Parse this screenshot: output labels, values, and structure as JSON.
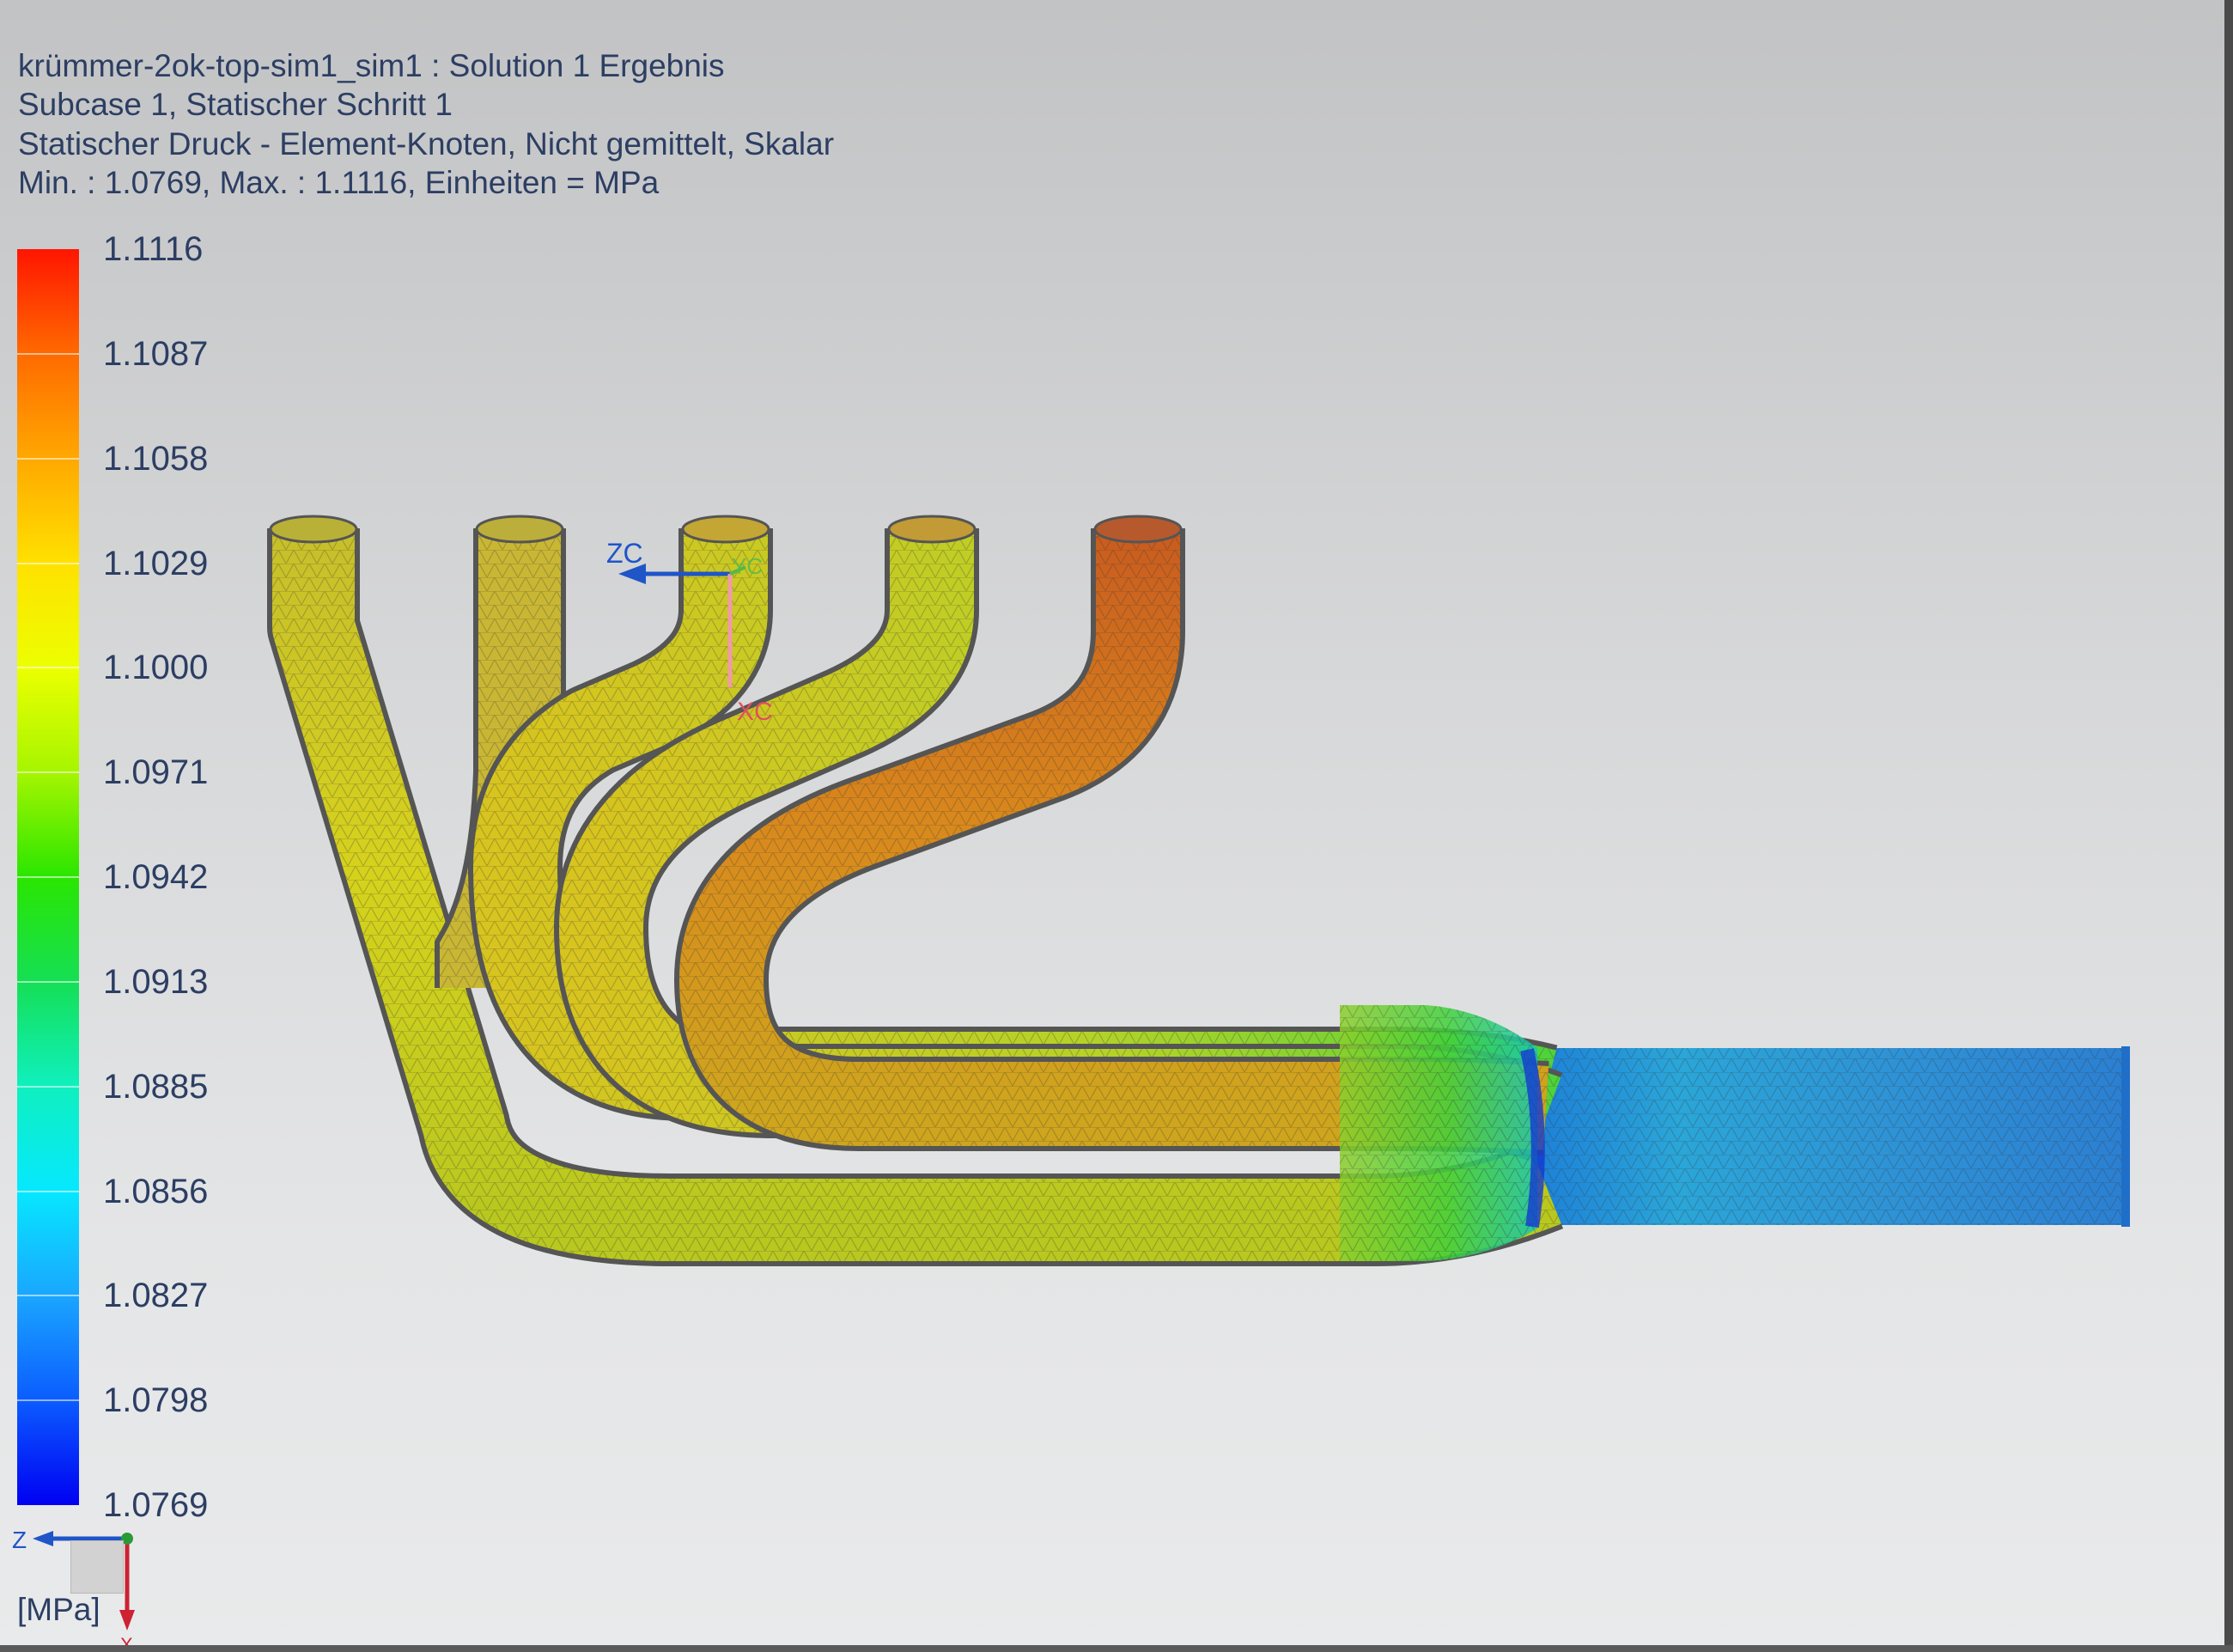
{
  "header": {
    "line1": "krümmer-2ok-top-sim1_sim1 : Solution 1 Ergebnis",
    "line2": "Subcase 1, Statischer Schritt 1",
    "line3": "Statischer Druck - Element-Knoten, Nicht gemittelt, Skalar",
    "line4": "Min. : 1.0769, Max. : 1.1116, Einheiten = MPa"
  },
  "legend": {
    "labels": [
      "1.1116",
      "1.1087",
      "1.1058",
      "1.1029",
      "1.1000",
      "1.0971",
      "1.0942",
      "1.0913",
      "1.0885",
      "1.0856",
      "1.0827",
      "1.0798",
      "1.0769"
    ],
    "units": "[MPa]"
  },
  "csys": {
    "zc": "ZC",
    "yc": "YC",
    "xc": "XC"
  },
  "triad": {
    "z": "Z",
    "x": "X"
  },
  "colors": {
    "text": "#2c3e63",
    "max": "#ff1500",
    "min": "#0000f2"
  }
}
